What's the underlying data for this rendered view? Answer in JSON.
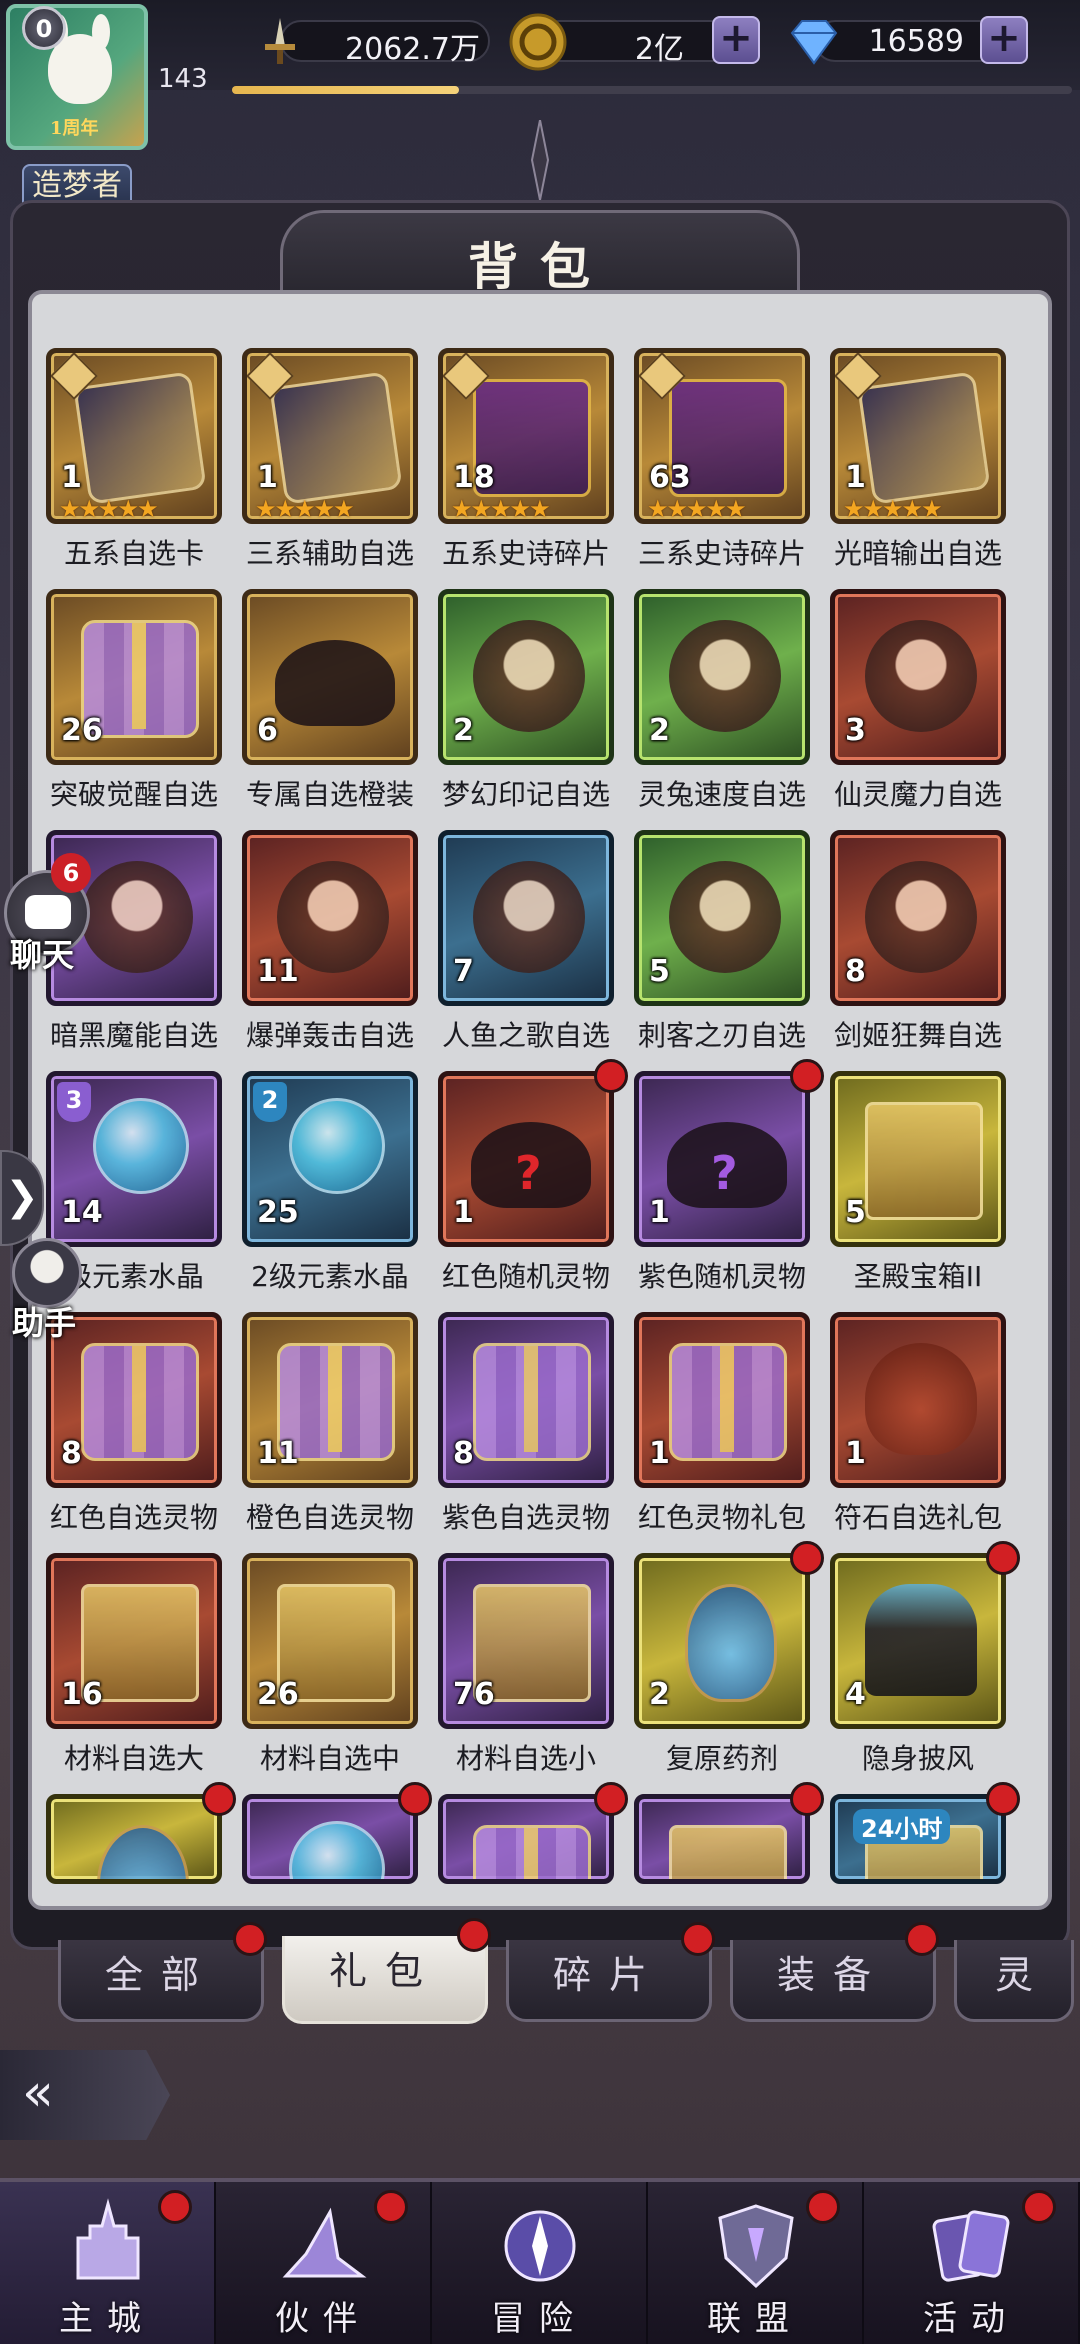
{
  "player": {
    "avatar_badge": "0",
    "avatar_tag": "1周年",
    "level": "143",
    "xp_progress": 0.27,
    "title": "造梦者",
    "title_stars": "◆◆◆◆◆"
  },
  "resources": {
    "power": "2062.7万",
    "gold": "2亿",
    "diamonds": "16589"
  },
  "panel": {
    "title": "背包"
  },
  "items": [
    {
      "name": "五系自选卡",
      "count": "1",
      "stars": "★★★★★",
      "frame": "gold",
      "art": "card",
      "corner": true
    },
    {
      "name": "三系辅助自选",
      "count": "1",
      "stars": "★★★★★",
      "frame": "gold",
      "art": "card",
      "corner": true
    },
    {
      "name": "五系史诗碎片",
      "count": "18",
      "stars": "★★★★★",
      "frame": "gold",
      "art": "chest",
      "corner": true
    },
    {
      "name": "三系史诗碎片",
      "count": "63",
      "stars": "★★★★★",
      "frame": "gold",
      "art": "chest",
      "corner": true
    },
    {
      "name": "光暗输出自选",
      "count": "1",
      "stars": "★★★★★",
      "frame": "gold",
      "art": "card",
      "corner": true
    },
    {
      "name": "突破觉醒自选",
      "count": "26",
      "frame": "gold",
      "art": "gift"
    },
    {
      "name": "专属自选橙装",
      "count": "6",
      "frame": "gold",
      "art": "lamp"
    },
    {
      "name": "梦幻印记自选",
      "count": "2",
      "frame": "green",
      "art": "hero"
    },
    {
      "name": "灵兔速度自选",
      "count": "2",
      "frame": "green",
      "art": "hero"
    },
    {
      "name": "仙灵魔力自选",
      "count": "3",
      "frame": "red",
      "art": "hero"
    },
    {
      "name": "暗黑魔能自选",
      "count": "",
      "frame": "purple",
      "art": "hero"
    },
    {
      "name": "爆弹轰击自选",
      "count": "11",
      "frame": "red",
      "art": "hero"
    },
    {
      "name": "人鱼之歌自选",
      "count": "7",
      "frame": "blue",
      "art": "hero"
    },
    {
      "name": "刺客之刃自选",
      "count": "5",
      "frame": "green",
      "art": "hero"
    },
    {
      "name": "剑姬狂舞自选",
      "count": "8",
      "frame": "red",
      "art": "hero"
    },
    {
      "name": "级元素水晶",
      "count": "14",
      "frame": "purple",
      "art": "orb",
      "grade": "3",
      "grade_class": "g3"
    },
    {
      "name": "2级元素水晶",
      "count": "25",
      "frame": "blue",
      "art": "orb",
      "grade": "2",
      "grade_class": "g2"
    },
    {
      "name": "红色随机灵物",
      "count": "1",
      "frame": "red",
      "art": "lamp",
      "qmark": "?",
      "qcolor": "#e0262b",
      "dot": true
    },
    {
      "name": "紫色随机灵物",
      "count": "1",
      "frame": "purple",
      "art": "lamp",
      "qmark": "?",
      "qcolor": "#a35be0",
      "dot": true
    },
    {
      "name": "圣殿宝箱II",
      "count": "5",
      "frame": "yellow",
      "art": "box"
    },
    {
      "name": "红色自选灵物",
      "count": "8",
      "frame": "red",
      "art": "gift"
    },
    {
      "name": "橙色自选灵物",
      "count": "11",
      "frame": "gold",
      "art": "gift"
    },
    {
      "name": "紫色自选灵物",
      "count": "8",
      "frame": "purple",
      "art": "gift"
    },
    {
      "name": "红色灵物礼包",
      "count": "1",
      "frame": "red",
      "art": "gift"
    },
    {
      "name": "符石自选礼包",
      "count": "1",
      "frame": "red",
      "art": "sack"
    },
    {
      "name": "材料自选大",
      "count": "16",
      "frame": "red",
      "art": "box"
    },
    {
      "name": "材料自选中",
      "count": "26",
      "frame": "gold",
      "art": "box"
    },
    {
      "name": "材料自选小",
      "count": "76",
      "frame": "purple",
      "art": "box"
    },
    {
      "name": "复原药剂",
      "count": "2",
      "frame": "yellow",
      "art": "potion",
      "dot": true
    },
    {
      "name": "隐身披风",
      "count": "4",
      "frame": "yellow",
      "art": "cloak",
      "dot": true
    },
    {
      "name": "",
      "count": "",
      "frame": "yellow",
      "art": "potion",
      "dot": true
    },
    {
      "name": "",
      "count": "",
      "frame": "purple",
      "art": "orb",
      "dot": true
    },
    {
      "name": "",
      "count": "",
      "frame": "purple",
      "art": "gift",
      "dot": true
    },
    {
      "name": "",
      "count": "",
      "frame": "purple",
      "art": "box",
      "dot": true
    },
    {
      "name": "",
      "count": "",
      "frame": "blue",
      "art": "box",
      "dot": true,
      "banner": "24小时"
    }
  ],
  "tabs": [
    {
      "label": "全部",
      "dot": true
    },
    {
      "label": "礼包",
      "dot": true,
      "active": true
    },
    {
      "label": "碎片",
      "dot": true
    },
    {
      "label": "装备",
      "dot": true
    },
    {
      "label": "灵",
      "dot": false
    }
  ],
  "side": {
    "chat_label": "聊天",
    "chat_badge": "6",
    "helper_label": "助手",
    "arrow": "❯"
  },
  "back_icon": "«",
  "nav": [
    {
      "label": "主城",
      "active": true,
      "dot": true,
      "icon": "castle-icon"
    },
    {
      "label": "伙伴",
      "dot": true,
      "icon": "witch-hat-icon"
    },
    {
      "label": "冒险",
      "dot": false,
      "icon": "portal-icon"
    },
    {
      "label": "联盟",
      "dot": true,
      "icon": "shield-icon"
    },
    {
      "label": "活动",
      "dot": true,
      "icon": "cards-icon"
    }
  ]
}
